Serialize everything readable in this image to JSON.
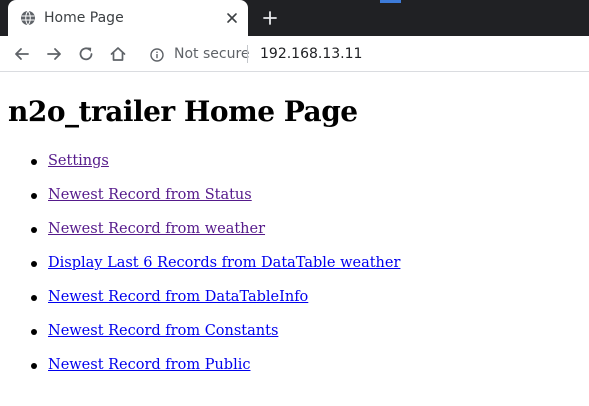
{
  "browser": {
    "tab_title": "Home Page",
    "security_label": "Not secure",
    "url": "192.168.13.11"
  },
  "page": {
    "title": "n2o_trailer Home Page",
    "links": [
      {
        "label": "Settings",
        "visited": true
      },
      {
        "label": "Newest Record from Status",
        "visited": true
      },
      {
        "label": "Newest Record from weather",
        "visited": true
      },
      {
        "label": "Display Last 6 Records from DataTable weather",
        "visited": false
      },
      {
        "label": "Newest Record from DataTableInfo",
        "visited": false
      },
      {
        "label": "Newest Record from Constants",
        "visited": false
      },
      {
        "label": "Newest Record from Public",
        "visited": false
      }
    ]
  },
  "colors": {
    "tabstrip": "#202124",
    "visited_link": "#551a8b",
    "unvisited_link": "#0000ee"
  },
  "icons": [
    "globe-icon",
    "close-icon",
    "plus-icon",
    "back-arrow-icon",
    "forward-arrow-icon",
    "reload-icon",
    "home-icon",
    "info-icon"
  ]
}
